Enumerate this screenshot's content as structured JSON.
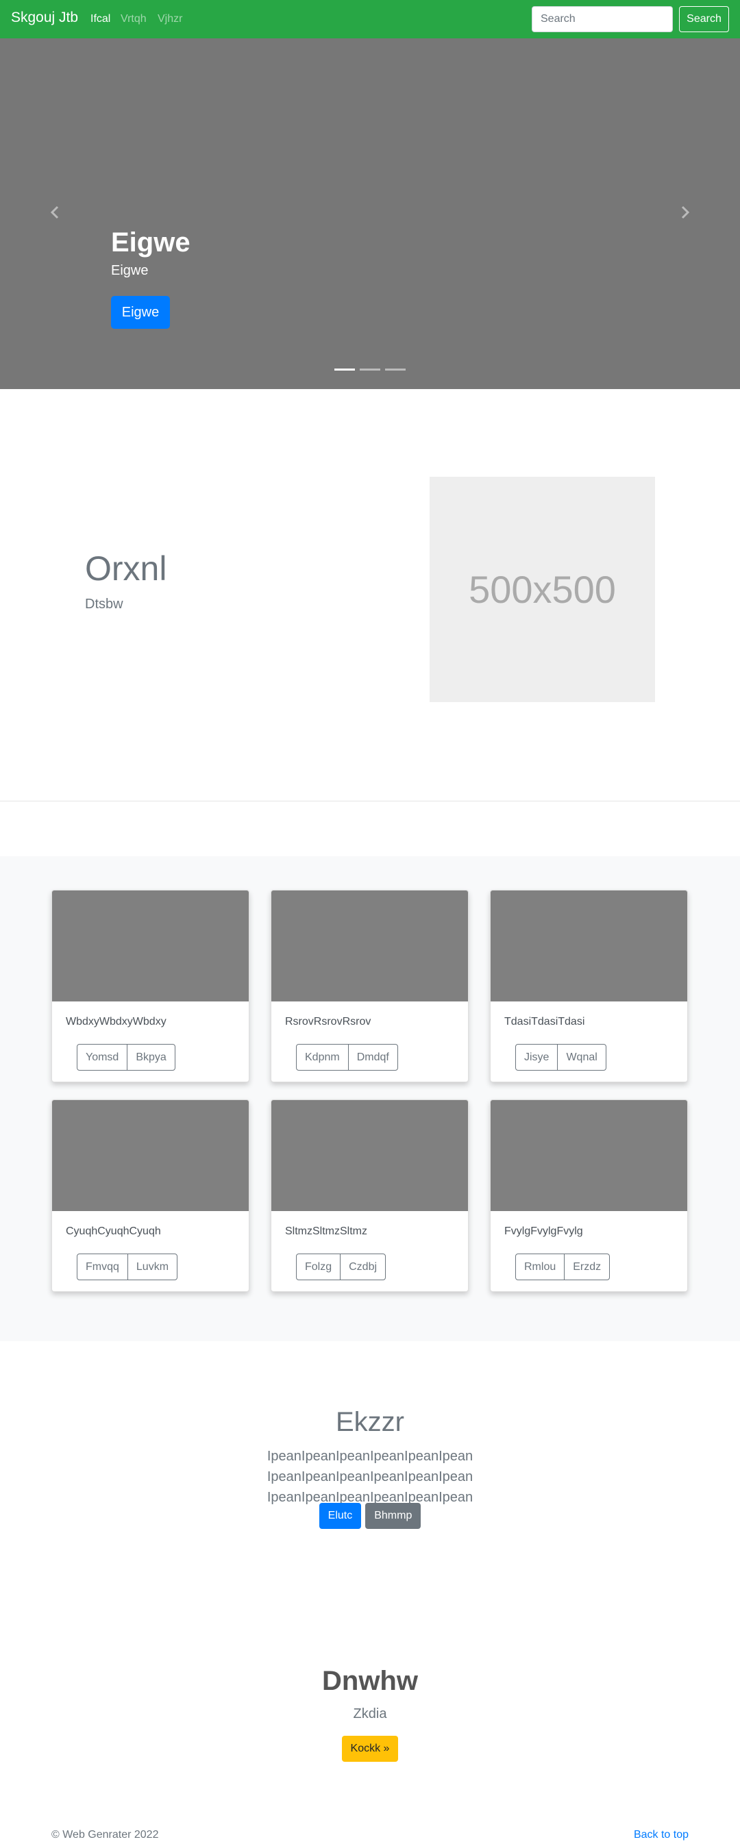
{
  "navbar": {
    "brand": "Skgouj Jtb",
    "links": [
      {
        "label": "Ifcal",
        "active": true
      },
      {
        "label": "Vrtqh",
        "active": false
      },
      {
        "label": "Vjhzr",
        "active": false
      }
    ],
    "search_placeholder": "Search",
    "search_button": "Search",
    "color": "#28a745"
  },
  "carousel": {
    "title": "Eigwe",
    "subtitle": "Eigwe",
    "button": "Eigwe",
    "prev_icon": "chevron-left-icon",
    "next_icon": "chevron-right-icon",
    "slide_count": 3,
    "active_slide": 1
  },
  "featurette": {
    "heading": "Orxnl",
    "subheading": "Dtsbw",
    "image_label": "500x500"
  },
  "album": {
    "cards": [
      {
        "text": "WbdxyWbdxyWbdxy",
        "buttons": [
          "Yomsd",
          "Bkpya"
        ]
      },
      {
        "text": "RsrovRsrovRsrov",
        "buttons": [
          "Kdpnm",
          "Dmdqf"
        ]
      },
      {
        "text": "TdasiTdasiTdasi",
        "buttons": [
          "Jisye",
          "Wqnal"
        ]
      },
      {
        "text": "CyuqhCyuqhCyuqh",
        "buttons": [
          "Fmvqq",
          "Luvkm"
        ]
      },
      {
        "text": "SltmzSltmzSltmz",
        "buttons": [
          "Folzg",
          "Czdbj"
        ]
      },
      {
        "text": "FvylgFvylgFvylg",
        "buttons": [
          "Rmlou",
          "Erzdz"
        ]
      }
    ]
  },
  "jumbotron": {
    "title": "Ekzzr",
    "lead": "IpeanIpeanIpeanIpeanIpeanIpean IpeanIpeanIpeanIpeanIpeanIpean IpeanIpeanIpeanIpeanIpeanIpean",
    "primary_button": "Elutc",
    "secondary_button": "Bhmmp"
  },
  "section2": {
    "title": "Dnwhw",
    "subtitle": "Zkdia",
    "button": "Kockk »"
  },
  "footer": {
    "copyright": "© Web Genrater 2022",
    "back_to_top": "Back to top"
  }
}
